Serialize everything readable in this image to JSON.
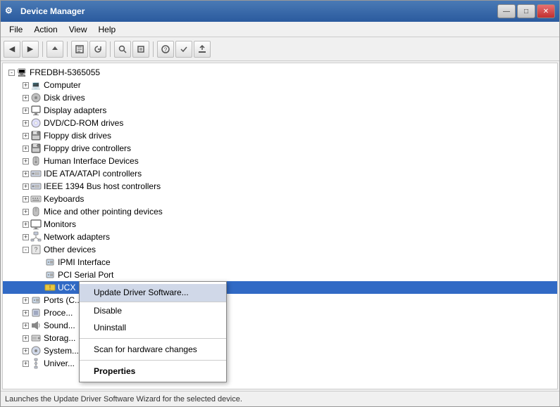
{
  "window": {
    "title": "Device Manager",
    "title_icon": "⚙"
  },
  "title_buttons": {
    "minimize": "—",
    "maximize": "□",
    "close": "✕"
  },
  "menu": {
    "items": [
      "File",
      "Action",
      "View",
      "Help"
    ]
  },
  "toolbar": {
    "buttons": [
      "←",
      "→",
      "⬆",
      "🖥",
      "↺",
      "🔍",
      "⊞",
      "❌",
      "⚡",
      "🔧"
    ]
  },
  "tree": {
    "root": "FREDBH-5365055",
    "items": [
      {
        "id": "computer",
        "label": "Computer",
        "level": 2,
        "icon": "💻",
        "expanded": true
      },
      {
        "id": "disk-drives",
        "label": "Disk drives",
        "level": 2,
        "icon": "💾",
        "expanded": false
      },
      {
        "id": "display-adapters",
        "label": "Display adapters",
        "level": 2,
        "icon": "🖥",
        "expanded": false
      },
      {
        "id": "dvd-cdrom",
        "label": "DVD/CD-ROM drives",
        "level": 2,
        "icon": "💿",
        "expanded": false
      },
      {
        "id": "floppy-disk",
        "label": "Floppy disk drives",
        "level": 2,
        "icon": "💾",
        "expanded": false
      },
      {
        "id": "floppy-drive",
        "label": "Floppy drive controllers",
        "level": 2,
        "icon": "💾",
        "expanded": false
      },
      {
        "id": "hid",
        "label": "Human Interface Devices",
        "level": 2,
        "icon": "🎮",
        "expanded": false
      },
      {
        "id": "ide-ata",
        "label": "IDE ATA/ATAPI controllers",
        "level": 2,
        "icon": "💾",
        "expanded": false
      },
      {
        "id": "ieee1394",
        "label": "IEEE 1394 Bus host controllers",
        "level": 2,
        "icon": "🔌",
        "expanded": false
      },
      {
        "id": "keyboards",
        "label": "Keyboards",
        "level": 2,
        "icon": "⌨",
        "expanded": false
      },
      {
        "id": "mice",
        "label": "Mice and other pointing devices",
        "level": 2,
        "icon": "🖱",
        "expanded": false
      },
      {
        "id": "monitors",
        "label": "Monitors",
        "level": 2,
        "icon": "🖥",
        "expanded": false
      },
      {
        "id": "network-adapters",
        "label": "Network adapters",
        "level": 2,
        "icon": "🌐",
        "expanded": false
      },
      {
        "id": "other-devices",
        "label": "Other devices",
        "level": 2,
        "icon": "❓",
        "expanded": true
      },
      {
        "id": "ipmi",
        "label": "IPMI Interface",
        "level": 3,
        "icon": "🔌",
        "expanded": false
      },
      {
        "id": "pci-serial",
        "label": "PCI Serial Port",
        "level": 3,
        "icon": "🔌",
        "expanded": false
      },
      {
        "id": "ucx",
        "label": "UCX",
        "level": 3,
        "icon": "⚠",
        "expanded": false,
        "selected": true
      },
      {
        "id": "ports",
        "label": "Ports (C...",
        "level": 2,
        "icon": "🔌",
        "expanded": false
      },
      {
        "id": "processors",
        "label": "Proce...",
        "level": 2,
        "icon": "⚙",
        "expanded": false
      },
      {
        "id": "sound",
        "label": "Sound...",
        "level": 2,
        "icon": "🔊",
        "expanded": false
      },
      {
        "id": "storage",
        "label": "Storag...",
        "level": 2,
        "icon": "💾",
        "expanded": false
      },
      {
        "id": "system",
        "label": "System...",
        "level": 2,
        "icon": "⚙",
        "expanded": false
      },
      {
        "id": "univer",
        "label": "Univer...",
        "level": 2,
        "icon": "🔌",
        "expanded": false
      }
    ]
  },
  "context_menu": {
    "items": [
      {
        "id": "update-driver",
        "label": "Update Driver Software...",
        "style": "highlighted"
      },
      {
        "id": "disable",
        "label": "Disable",
        "style": "normal"
      },
      {
        "id": "uninstall",
        "label": "Uninstall",
        "style": "normal"
      },
      {
        "id": "sep1",
        "label": "",
        "style": "separator"
      },
      {
        "id": "scan-hardware",
        "label": "Scan for hardware changes",
        "style": "normal"
      },
      {
        "id": "sep2",
        "label": "",
        "style": "separator"
      },
      {
        "id": "properties",
        "label": "Properties",
        "style": "bold"
      }
    ]
  },
  "status_bar": {
    "text": "Launches the Update Driver Software Wizard for the selected device."
  }
}
